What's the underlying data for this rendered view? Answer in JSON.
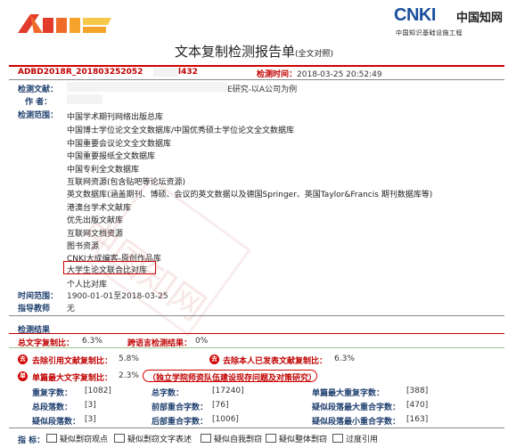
{
  "colors": {
    "brand_red": "#c00000",
    "label_blue": "#1f3f6e",
    "cnki_blue": "#1a4f9c"
  },
  "brand": {
    "left_logo": "amlc-logo",
    "cnki_word": "CNKI",
    "cnki_cn": "中国知网",
    "cnki_sub": "中国知识基础设施工程"
  },
  "title": {
    "main": "文本复制检测报告单",
    "sub": "(全文对照)"
  },
  "report": {
    "id": "ADBD2018R_201803252052",
    "id_tail": "l432",
    "time_label": "检测时间：",
    "time_value": "2018-03-25 20:52:49",
    "doc_label": "检测文献：",
    "doc_value_tail": "E研究-以A公司为例",
    "author_label": "作  者：",
    "range_label": "检测范围：",
    "period_label": "时间范围：",
    "period_value": "1900-01-01至2018-03-25",
    "advisor_label": "指导教师",
    "advisor_value": "无"
  },
  "databases": [
    "中国学术期刊网络出版总库",
    "中国博士学位论文全文数据库/中国优秀硕士学位论文全文数据库",
    "中国重要会议论文全文数据库",
    "中国重要报纸全文数据库",
    "中国专利全文数据库",
    "互联网资源(包含贴吧等论坛资源)",
    "英文数据库(涵盖期刊、博硕、会议的英文数据以及德国Springer、英国Taylor&Francis 期刊数据库等)",
    "港澳台学术文献库",
    "优先出版文献库",
    "互联网文档资源",
    "图书资源",
    "CNKI大成编客-原创作品库",
    "大学生论文联合比对库",
    "个人比对库"
  ],
  "results": {
    "section_label": "检测结果",
    "total_label": "总文字复制比：",
    "total_value": "6.3%",
    "cross_label": "跨语言检测结果：",
    "cross_value": "0%",
    "excl_ref_badge": "去",
    "excl_ref_label": "去除引用文献复制比：",
    "excl_ref_value": "5.8%",
    "excl_self_badge": "去",
    "excl_self_label": "去除本人已发表文献复制比：",
    "excl_self_value": "6.3%",
    "single_badge": "单",
    "single_label": "单篇最大文字复制比：",
    "single_value": "2.3%",
    "single_source": "（独立学院师资队伍建设现存问题及对策研究）",
    "grid": [
      {
        "label": "重复字数：",
        "value": "[1082]"
      },
      {
        "label": "总字数：",
        "value": "[17240]"
      },
      {
        "label": "单篇最大重复字数：",
        "value": "[388]"
      },
      {
        "label": "总段落数：",
        "value": "[3]"
      },
      {
        "label": "前部重合字数：",
        "value": "[76]"
      },
      {
        "label": "疑似段落最大重合字数：",
        "value": "[470]"
      },
      {
        "label": "疑似段落数：",
        "value": "[3]"
      },
      {
        "label": "后部重合字数：",
        "value": "[1006]"
      },
      {
        "label": "疑似段落最小重合字数：",
        "value": "[163]"
      }
    ]
  },
  "legend": {
    "label": "指  标：",
    "items": [
      "疑似剽窃观点",
      "疑似剽窃文字表述",
      "疑似自我剽窃",
      "疑似整体剽窃",
      "过度引用"
    ]
  },
  "watermark": "中国知网"
}
